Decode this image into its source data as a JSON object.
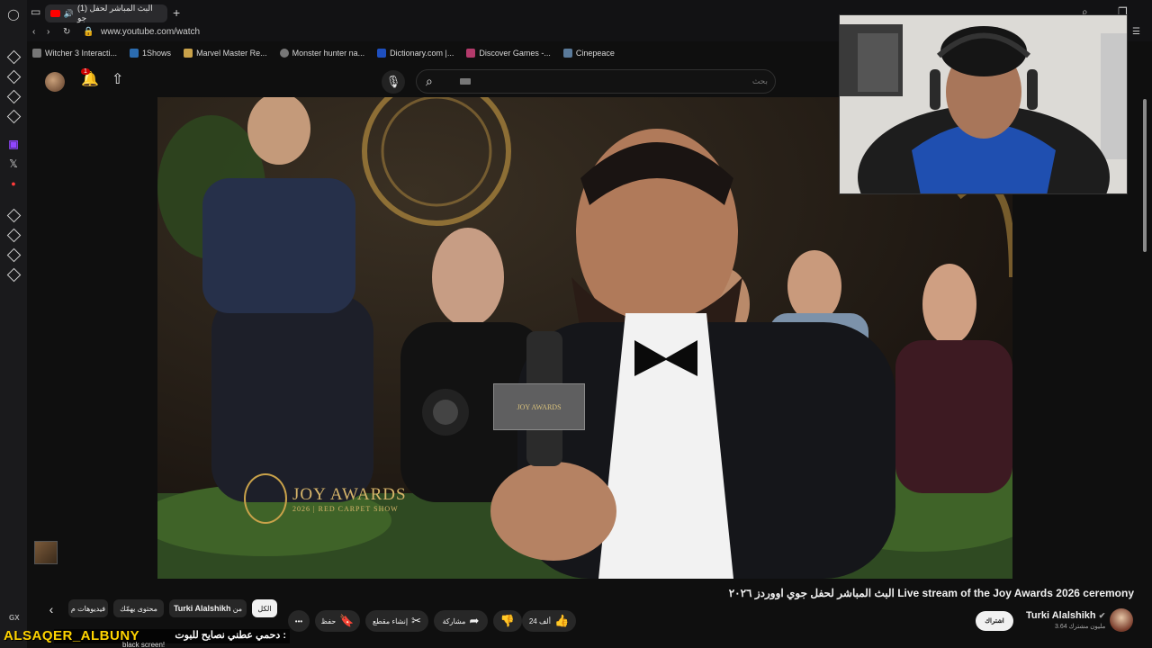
{
  "browser": {
    "tab_title": "(1) البث المباشر لحفل جو",
    "url": "www.youtube.com/watch",
    "bookmarks": [
      {
        "label": "Witcher 3 Interacti..."
      },
      {
        "label": "1Shows"
      },
      {
        "label": "Marvel Master Re..."
      },
      {
        "label": "Monster hunter na..."
      },
      {
        "label": "Dictionary.com |..."
      },
      {
        "label": "Discover Games -..."
      },
      {
        "label": "Cinepeace"
      }
    ]
  },
  "youtube": {
    "notification_count": "1",
    "search_placeholder": "بحث",
    "video": {
      "title": "البث المباشر لحفل جوي اووردز ٢٠٢٦ Live stream of the Joy Awards 2026 ceremony",
      "brand_text": "JOY AWARDS",
      "brand_subtext": "2026 | RED CARPET SHOW",
      "mic_flag_text": "JOY AWARDS"
    },
    "channel": {
      "name": "Turki Alalshikh",
      "subscribers": "3.64 مليون مشترك",
      "subscribe_label": "اشتراك"
    },
    "actions": {
      "likes": "24 ألف",
      "share": "مشاركة",
      "clip": "إنشاء مقطع",
      "save": "حفظ",
      "more": "•••"
    },
    "chips": {
      "all": "الكل",
      "from_prefix": "من",
      "from_channel": "Turki Alalshikh",
      "related": "محتوى يهمّك",
      "videos": "فيديوهات م"
    }
  },
  "stream_overlay": {
    "streamer": "ALSAQER_ALBUNY",
    "message": "دحمي عطني نصايح للبوت :",
    "message2": "black screen!"
  },
  "colors": {
    "background": "#0f0f0f",
    "accent_red": "#ff0000",
    "overlay_name": "#ffd400",
    "joy_gold": "#d7b56a"
  }
}
